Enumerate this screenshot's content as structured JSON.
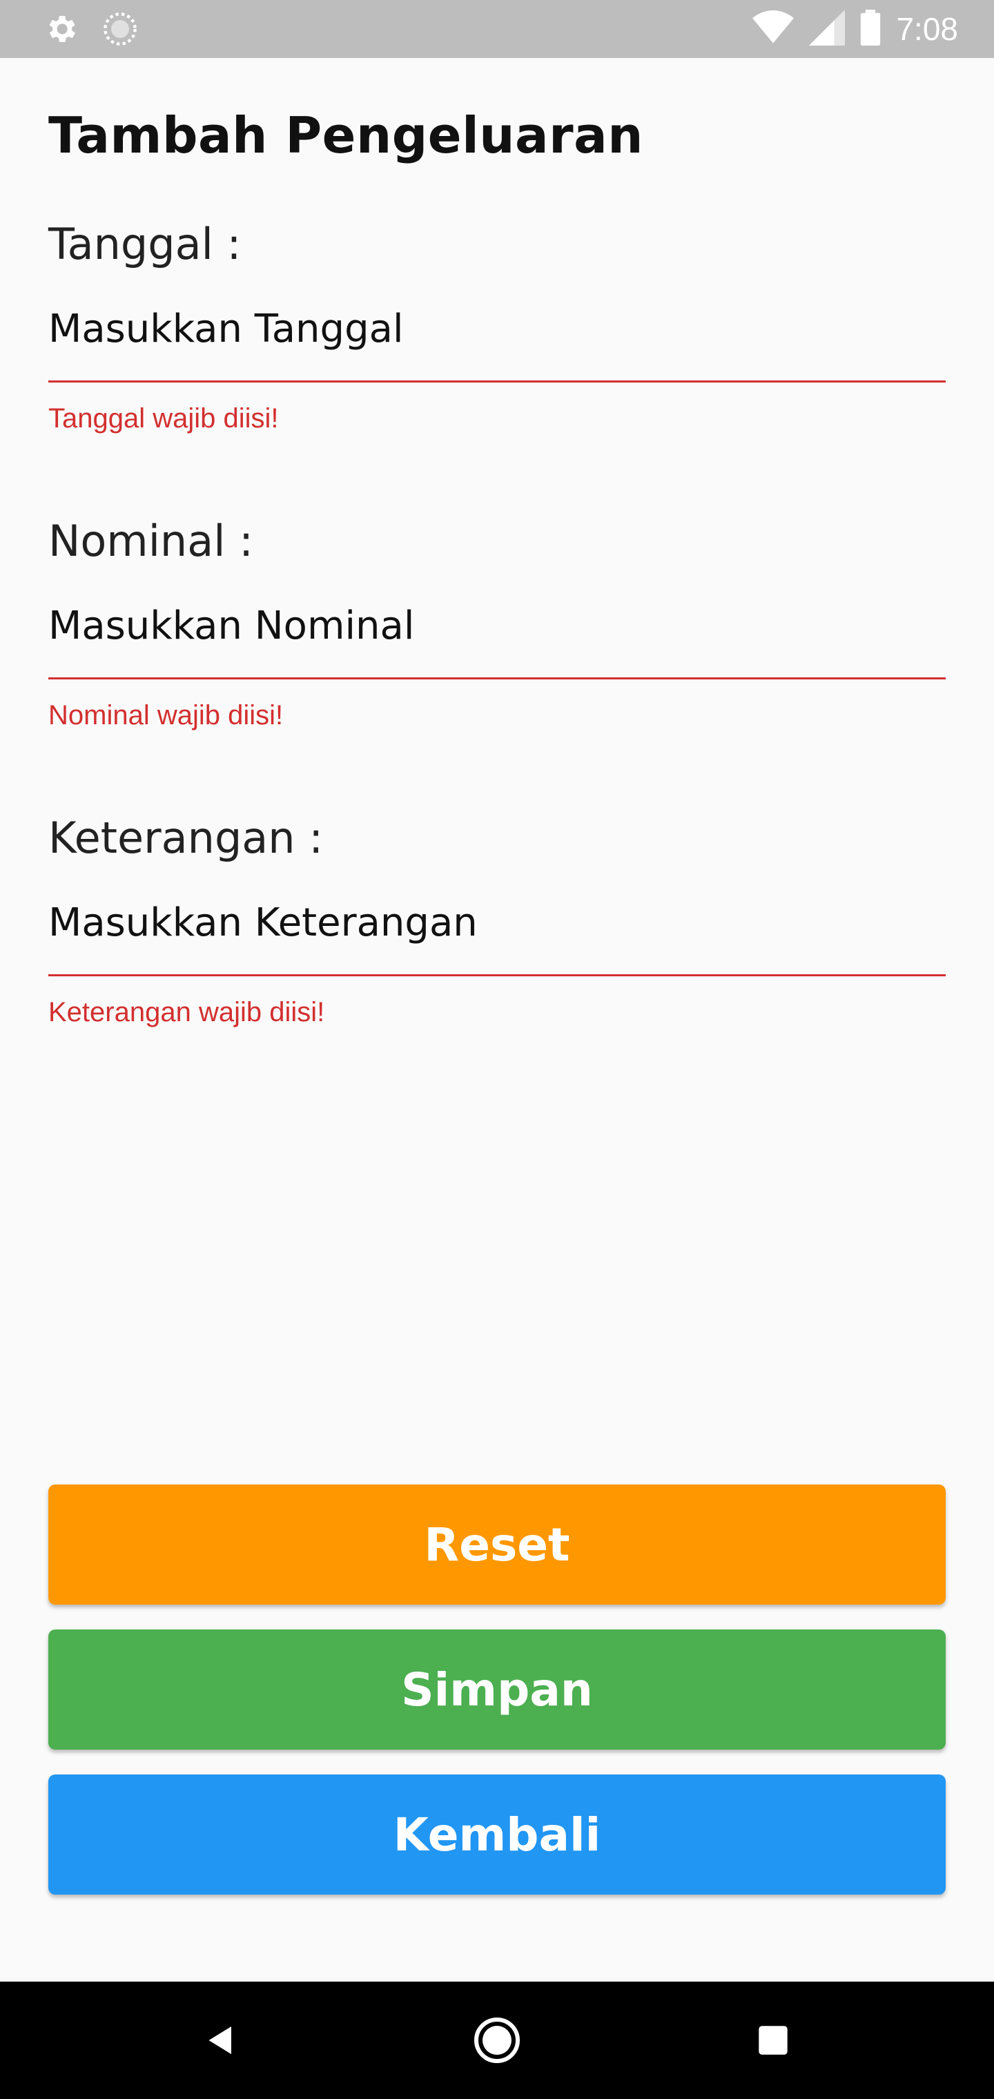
{
  "status_bar": {
    "time": "7:08",
    "icons_left": [
      "settings-icon",
      "sync-icon"
    ],
    "icons_right": [
      "wifi-icon",
      "signal-icon",
      "battery-icon"
    ]
  },
  "page": {
    "title": "Tambah Pengeluaran"
  },
  "form": {
    "tanggal": {
      "label": "Tanggal :",
      "placeholder": "Masukkan Tanggal",
      "error": "Tanggal wajib diisi!"
    },
    "nominal": {
      "label": "Nominal :",
      "placeholder": "Masukkan Nominal",
      "error": "Nominal wajib diisi!"
    },
    "keterangan": {
      "label": "Keterangan :",
      "placeholder": "Masukkan Keterangan",
      "error": "Keterangan wajib diisi!"
    }
  },
  "buttons": {
    "reset": "Reset",
    "simpan": "Simpan",
    "kembali": "Kembali"
  },
  "colors": {
    "reset": "#ff9800",
    "simpan": "#4caf50",
    "kembali": "#2196f3",
    "error": "#d32f2f"
  },
  "nav_bar": {
    "icons": [
      "back-icon",
      "home-icon",
      "recents-icon"
    ]
  }
}
